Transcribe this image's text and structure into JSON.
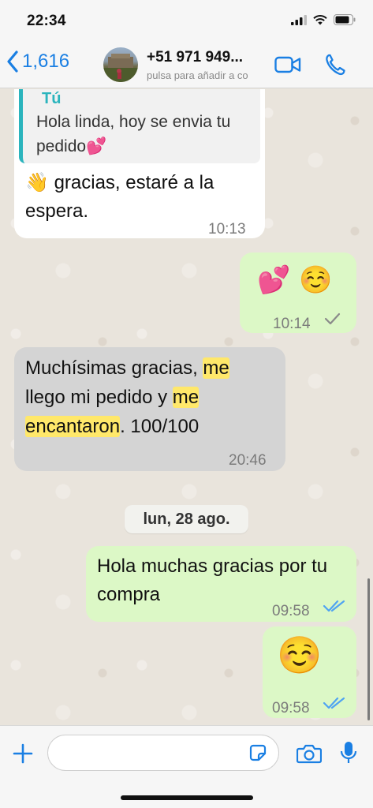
{
  "status_bar": {
    "time": "22:34"
  },
  "header": {
    "back_count": "1,616",
    "contact_name": "+51 971 949...",
    "contact_subtitle": "pulsa para añadir a co"
  },
  "messages": {
    "m1": {
      "reply_author": "Tú",
      "reply_text": "Hola linda, hoy se envia tu pedido💕",
      "emoji": "👋",
      "text": "gracias, estaré a la espera.",
      "time": "10:13"
    },
    "m2": {
      "emoji": "💕 ☺️",
      "time": "10:14"
    },
    "m3": {
      "text_part1": "Muchísimas gracias,",
      "hl1": "me",
      "text_part2": "llego mi pedido y",
      "hl2": "me",
      "hl3": "encantaron",
      "text_part3": ". 100/100",
      "time": "20:46"
    },
    "date_separator": "lun, 28 ago.",
    "m4": {
      "text": "Hola muchas gracias por tu compra",
      "time": "09:58"
    },
    "m5": {
      "emoji": "☺️",
      "time": "09:58"
    }
  },
  "input": {
    "placeholder": ""
  },
  "colors": {
    "accent": "#1a7fe3",
    "outgoing_bubble": "#dcf8c6",
    "incoming_bubble": "#ffffff",
    "read_ticks": "#4fa3f2",
    "reply_bar": "#2bb4bd",
    "highlight": "#ffe86a"
  },
  "icons": [
    "back-chevron-icon",
    "video-call-icon",
    "phone-call-icon",
    "plus-icon",
    "sticker-icon",
    "camera-icon",
    "microphone-icon",
    "signal-icon",
    "wifi-icon",
    "battery-icon"
  ]
}
